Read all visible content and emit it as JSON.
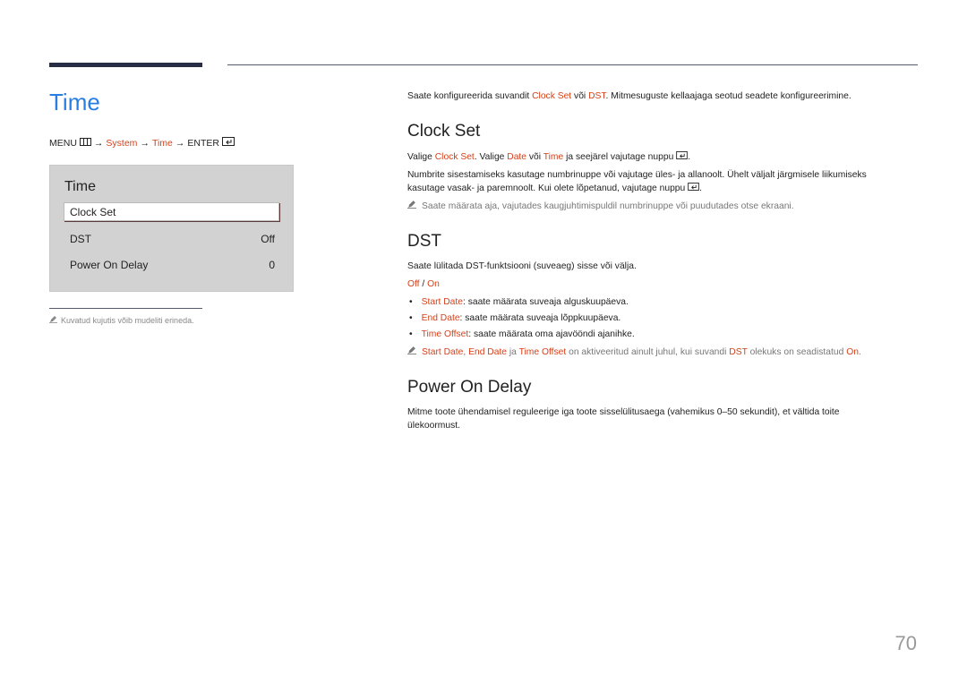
{
  "page": {
    "title": "Time",
    "page_number": "70"
  },
  "menu_path": {
    "menu": "MENU",
    "arrow": "→",
    "system": "System",
    "time": "Time",
    "enter": "ENTER"
  },
  "osd": {
    "title": "Time",
    "items": [
      {
        "label": "Clock Set",
        "value": ""
      },
      {
        "label": "DST",
        "value": "Off"
      },
      {
        "label": "Power On Delay",
        "value": "0"
      }
    ]
  },
  "left_note": "Kuvatud kujutis võib mudeliti erineda.",
  "intro": {
    "p1": "Saate konfigureerida suvandit ",
    "clock_set": "Clock Set",
    "p2": " või ",
    "dst": "DST",
    "p3": ". Mitmesuguste kellaajaga seotud seadete konfigureerimine."
  },
  "clock_set": {
    "heading": "Clock Set",
    "line1_a": "Valige ",
    "line1_clock": "Clock Set",
    "line1_b": ". Valige ",
    "line1_date": "Date",
    "line1_c": " või ",
    "line1_time": "Time",
    "line1_d": " ja seejärel vajutage nuppu",
    "line1_e": ".",
    "para2_a": "Numbrite sisestamiseks kasutage numbrinuppe või vajutage üles- ja allanoolt. Ühelt väljalt järgmisele liikumiseks",
    "para2_b": "kasutage vasak- ja paremnoolt. Kui olete lõpetanud, vajutage nuppu",
    "para2_c": ".",
    "note": "Saate määrata aja, vajutades kaugjuhtimispuldil numbrinuppe või puudutades otse ekraani."
  },
  "dst": {
    "heading": "DST",
    "desc": "Saate lülitada DST-funktsiooni (suveaeg) sisse või välja.",
    "opt_off": "Off",
    "opt_sep": " / ",
    "opt_on": "On",
    "bullets": [
      {
        "term": "Start Date",
        "text": ": saate määrata suveaja alguskuupäeva."
      },
      {
        "term": "End Date",
        "text": ": saate määrata suveaja lõppkuupäeva."
      },
      {
        "term": "Time Offset",
        "text": ": saate määrata oma ajavööndi ajanihke."
      }
    ],
    "note": {
      "start": "Start Date",
      "comma": ", ",
      "end": "End Date",
      "ja": " ja ",
      "offset": "Time Offset",
      "mid": " on aktiveeritud ainult juhul, kui suvandi ",
      "dst": "DST",
      "tail": " olekuks on seadistatud ",
      "on": "On",
      "dot": "."
    }
  },
  "power_on_delay": {
    "heading": "Power On Delay",
    "desc_a": "Mitme toote ühendamisel reguleerige iga toote sisselülitusaega (vahemikus 0–50 sekundit), et vältida toite",
    "desc_b": "ülekoormust."
  }
}
